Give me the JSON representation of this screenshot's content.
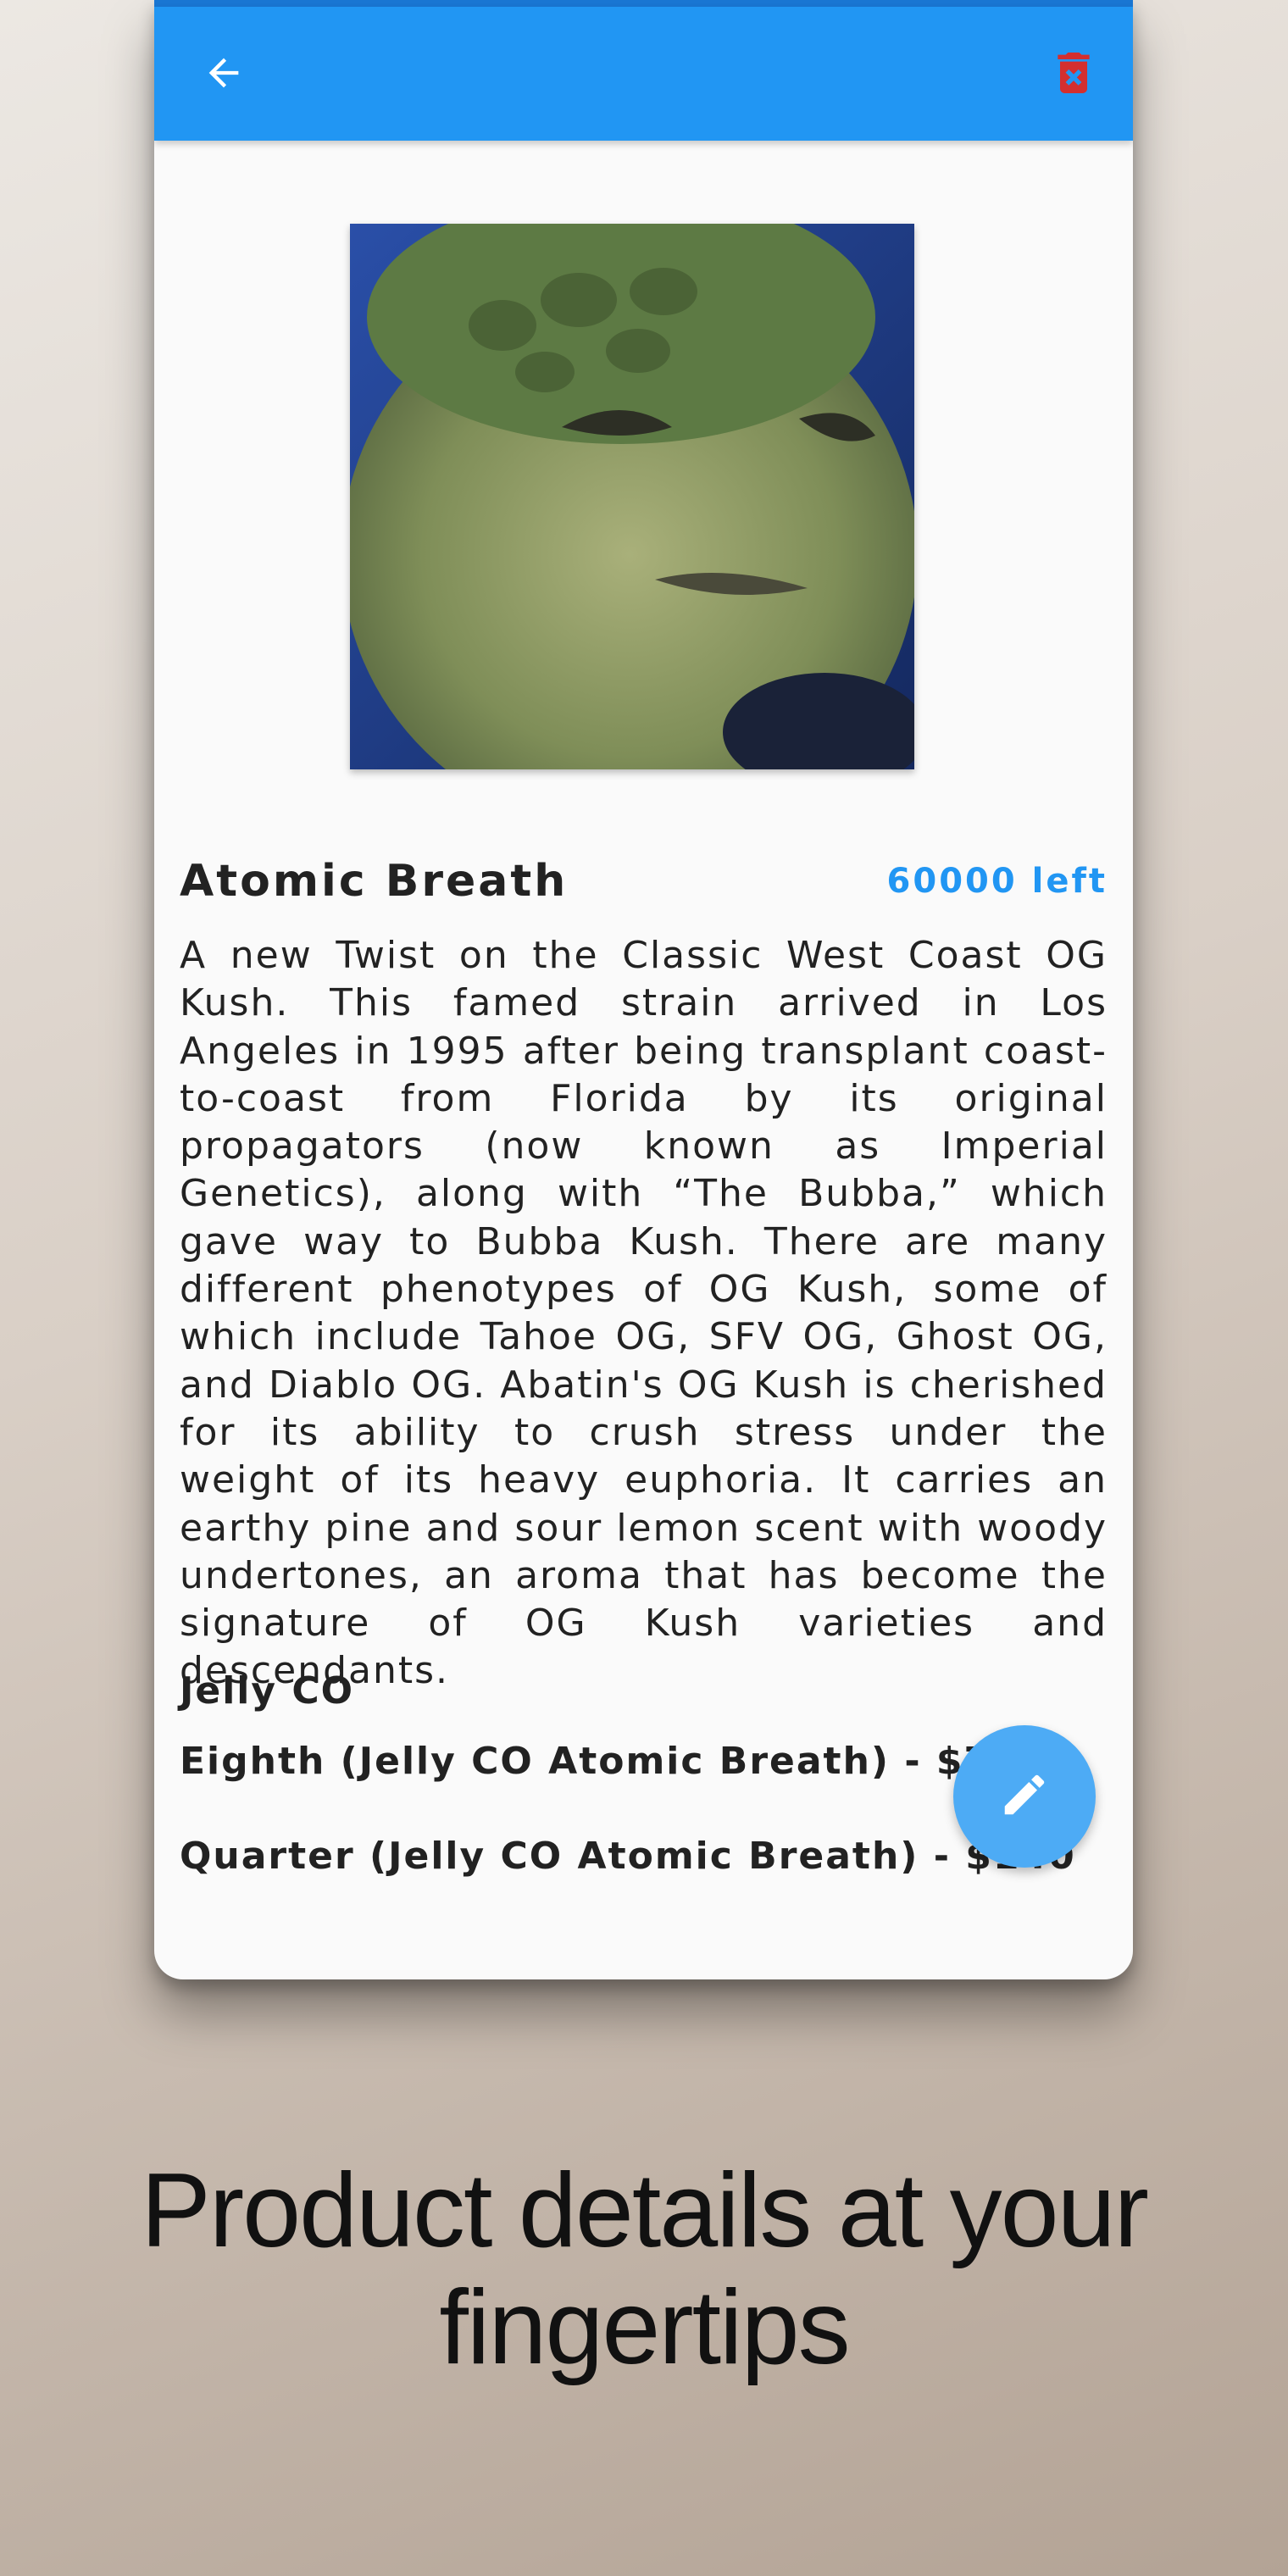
{
  "appbar": {
    "back_icon": "arrow-left-icon",
    "delete_icon": "delete-forever-icon",
    "colors": {
      "primary": "#2196f3",
      "delete": "#d32f2f"
    }
  },
  "product": {
    "image_alt": "product photo",
    "title": "Atomic Breath",
    "stock": "60000 left",
    "description": "A new Twist on the Classic West Coast OG Kush. This famed strain arrived in Los Angeles in 1995 after being transplant coast-to-coast from Florida by its original propagators (now known as Imperial Genetics), along with “The Bubba,” which gave way to Bubba Kush. There are many different phenotypes of OG Kush, some of which include Tahoe OG, SFV OG, Ghost OG, and Diablo OG. Abatin's OG Kush is cherished for its ability to crush stress under the weight of its heavy euphoria. It carries an earthy pine and sour lemon scent with woody undertones, an aroma that has become the signature of OG Kush varieties and descendants.",
    "brand": "Jelly CO",
    "options": [
      "Eighth (Jelly CO Atomic Breath) - $70",
      "Quarter (Jelly CO Atomic Breath) - $140"
    ]
  },
  "fab": {
    "icon": "pencil-edit-icon",
    "color": "#4dabf5"
  },
  "tagline": {
    "line1": "Product details at your",
    "line2": "fingertips"
  }
}
